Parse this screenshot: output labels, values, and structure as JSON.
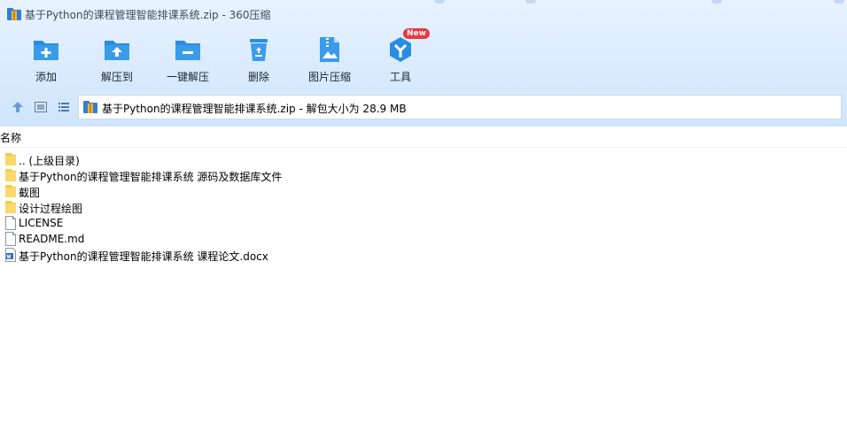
{
  "window": {
    "title": "基于Python的课程管理智能排课系统.zip - 360压缩"
  },
  "toolbar": {
    "items": [
      {
        "label": "添加",
        "icon": "add-folder-icon"
      },
      {
        "label": "解压到",
        "icon": "extract-to-icon"
      },
      {
        "label": "一键解压",
        "icon": "one-click-extract-icon"
      },
      {
        "label": "删除",
        "icon": "recycle-bin-icon"
      },
      {
        "label": "图片压缩",
        "icon": "image-compress-icon"
      },
      {
        "label": "工具",
        "icon": "tools-icon"
      }
    ],
    "new_badge": "New"
  },
  "address": {
    "text": "基于Python的课程管理智能排课系统.zip - 解包大小为 28.9 MB"
  },
  "list": {
    "column_name": "名称",
    "rows": [
      {
        "name": ".. (上级目录)",
        "type": "folder"
      },
      {
        "name": "基于Python的课程管理智能排课系统 源码及数据库文件",
        "type": "folder"
      },
      {
        "name": "截图",
        "type": "folder"
      },
      {
        "name": "设计过程绘图",
        "type": "folder"
      },
      {
        "name": "LICENSE",
        "type": "file"
      },
      {
        "name": "README.md",
        "type": "file"
      },
      {
        "name": "基于Python的课程管理智能排课系统 课程论文.docx",
        "type": "docx"
      }
    ]
  },
  "colors": {
    "toolbar_bg": "#d9eafd",
    "icon_blue": "#2b8de0",
    "folder_yellow": "#f7c948",
    "badge_red": "#e8383d"
  }
}
